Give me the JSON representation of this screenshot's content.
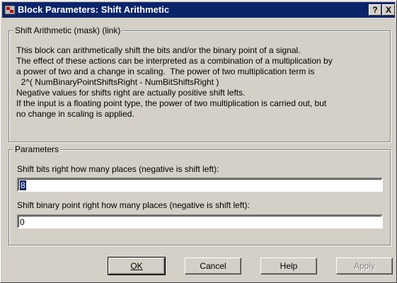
{
  "window": {
    "title": "Block Parameters: Shift Arithmetic",
    "help_glyph": "?",
    "close_glyph": "X"
  },
  "description_group": {
    "legend": "Shift Arithmetic (mask) (link)",
    "text": "This block can arithmetically shift the bits and/or the binary point of a signal.\nThe effect of these actions can be interpreted as a combination of a multiplication by\na power of two and a change in scaling.  The power of two multiplication term is\n  2^( NumBinaryPointShiftsRight - NumBitShiftsRight )\nNegative values for shifts right are actually positive shift lefts.\nIf the input is a floating point type, the power of two multiplication is carried out, but\nno change in scaling is applied."
  },
  "parameters": {
    "legend": "Parameters",
    "bits_label": "Shift bits right how many places (negative is shift left):",
    "bits_value": "8",
    "binary_label": "Shift binary point right how many places (negative is shift left):",
    "binary_value": "0"
  },
  "buttons": {
    "ok": "OK",
    "cancel": "Cancel",
    "help": "Help",
    "apply": "Apply"
  },
  "icons": {
    "title_icon": "simulink-block-icon",
    "help": "help-icon",
    "close": "close-icon"
  },
  "colors": {
    "titlebar": "#0a246a",
    "face": "#d4d0c8",
    "selection": "#0a246a"
  }
}
